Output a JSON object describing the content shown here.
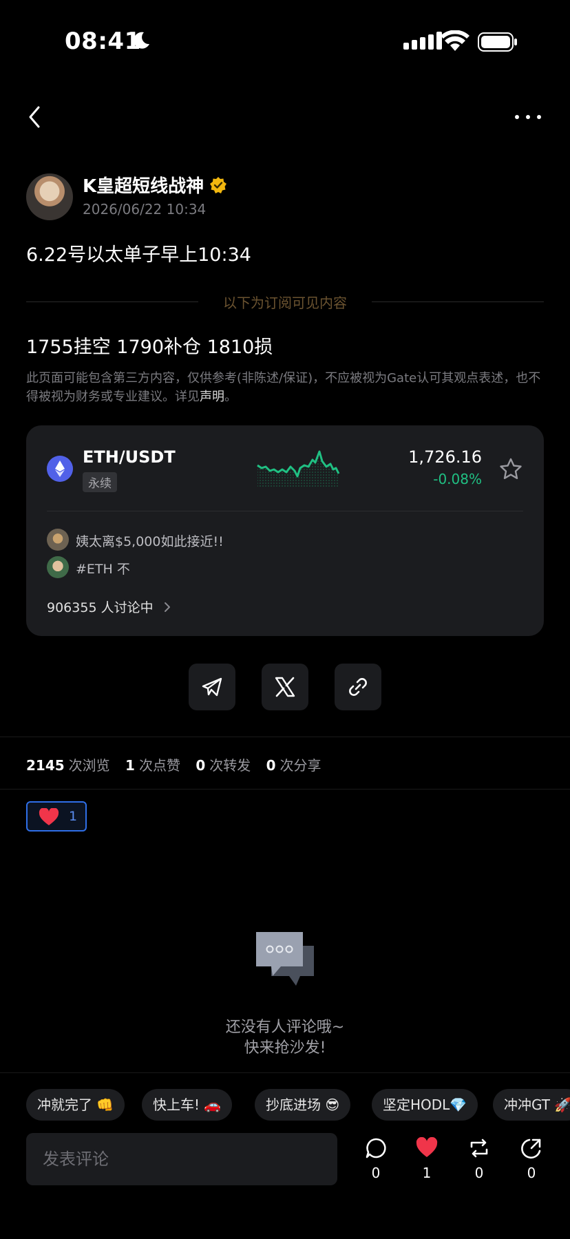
{
  "status_bar": {
    "time": "08:41"
  },
  "post": {
    "author": "K皇超短线战神",
    "date": "2026/06/22 10:34",
    "title": "6.22号以太单子早上10:34",
    "subscription_divider": "以下为订阅可见内容",
    "content": "1755挂空 1790补仓 1810损",
    "disclaimer_text": "此页面可能包含第三方内容，仅供参考(非陈述/保证)，不应被视为Gate认可其观点表述，也不得被视为财务或专业建议。详见",
    "disclaimer_link": "声明",
    "disclaimer_end": "。"
  },
  "market_card": {
    "pair": "ETH/USDT",
    "type_badge": "永续",
    "price": "1,726.16",
    "change": "-0.08%",
    "comments": [
      {
        "text": "姨太离$5,000如此接近!!"
      },
      {
        "text": "#ETH 不"
      }
    ],
    "discussion": "906355 人讨论中"
  },
  "stats": {
    "views_count": "2145",
    "views_label": "次浏览",
    "likes_count": "1",
    "likes_label": "次点赞",
    "reposts_count": "0",
    "reposts_label": "次转发",
    "shares_count": "0",
    "shares_label": "次分享"
  },
  "reaction": {
    "count": "1"
  },
  "empty_state": {
    "line1": "还没有人评论哦~",
    "line2": "快来抢沙发!"
  },
  "quick_replies": [
    "冲就完了 👊",
    "快上车! 🚗",
    "抄底进场 😎",
    "坚定HODL💎",
    "冲冲GT 🚀"
  ],
  "comment_box": {
    "placeholder": "发表评论"
  },
  "actions": {
    "comments": "0",
    "likes": "1",
    "reposts": "0",
    "shares": "0"
  },
  "colors": {
    "accent_green": "#20c083",
    "like_red": "#f0354a",
    "link_blue": "#2f6fe8",
    "divider_gold": "#6b5330"
  }
}
